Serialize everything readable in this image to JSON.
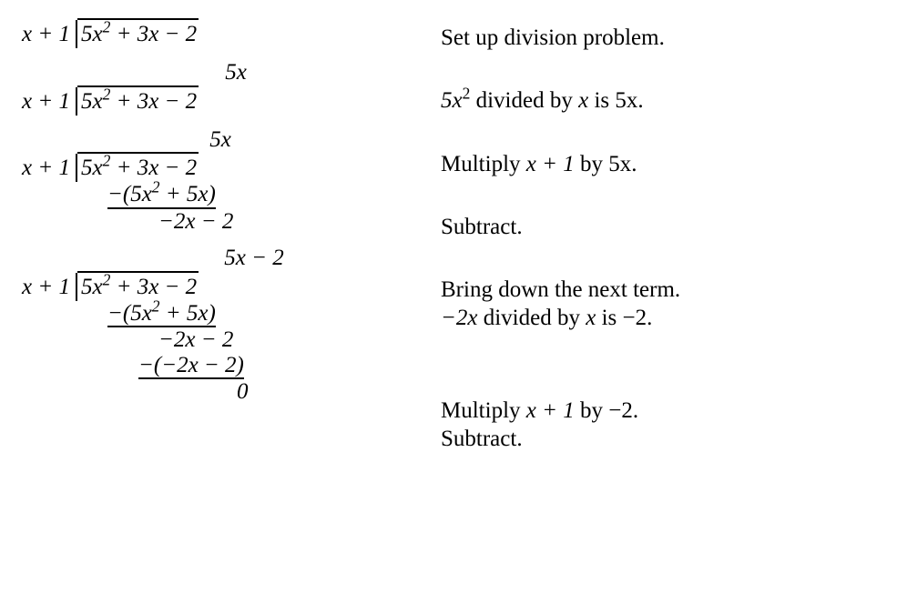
{
  "chart_data": {
    "type": "table",
    "title": "Polynomial long division of 5x^2 + 3x - 2 by x + 1",
    "steps": [
      {
        "expression": "x + 1 | 5x^2 + 3x - 2",
        "explanation": "Set up division problem."
      },
      {
        "expression": "quotient: 5x",
        "explanation": "5x^2 divided by x is 5x."
      },
      {
        "expression": "-(5x^2 + 5x)",
        "explanation": "Multiply x + 1 by 5x."
      },
      {
        "expression": "= -2x - 2",
        "explanation": "Subtract."
      },
      {
        "expression": "quotient: 5x - 2",
        "explanation": "Bring down the next term. -2x divided by x is -2."
      },
      {
        "expression": "-(-2x - 2) = 0",
        "explanation": "Multiply x + 1 by -2. Subtract."
      }
    ]
  },
  "left": {
    "divisor": "x + 1",
    "dividend_a": "5x",
    "dividend_b": " + 3x − 2",
    "q1": "5x",
    "q2": "5x − 2",
    "sub1": "−(5x",
    "sub1b": " + 5x)",
    "rem1": "−2x − 2",
    "sub2": "−(−2x − 2)",
    "rem2": "0"
  },
  "right": {
    "e1": "Set up division problem.",
    "e2a": "5x",
    "e2b": " divided by ",
    "e2c": "x",
    "e2d": " is 5x.",
    "e3a": "Multiply ",
    "e3b": "x + 1",
    "e3c": " by  5x.",
    "e4": "Subtract.",
    "e5": "Bring down the next term.",
    "e6a": "−2x",
    "e6b": " divided by ",
    "e6c": "x",
    "e6d": " is −2.",
    "e7a": "Multiply  ",
    "e7b": "x + 1",
    "e7c": " by −2.",
    "e8": "Subtract."
  }
}
